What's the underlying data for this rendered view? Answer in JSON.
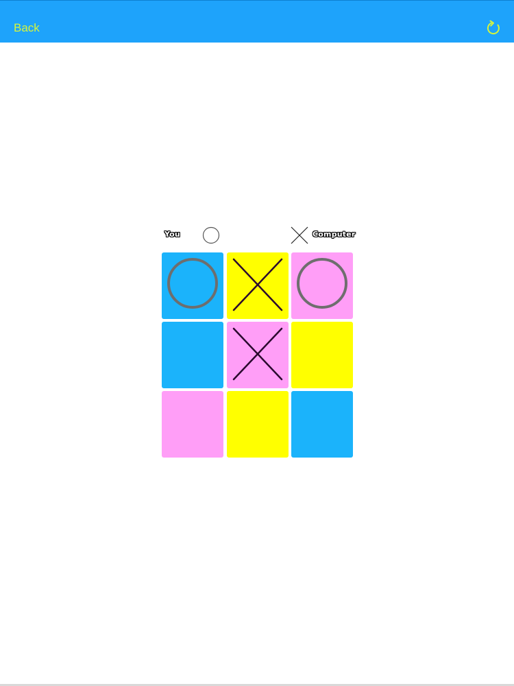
{
  "nav": {
    "back_label": "Back",
    "refresh_icon": "refresh-icon",
    "bar_color": "#1ea3fb",
    "text_color": "#d6f53b"
  },
  "players": {
    "you": {
      "label": "You",
      "symbol": "O"
    },
    "computer": {
      "label": "Computer",
      "symbol": "X"
    }
  },
  "board": {
    "cells": [
      {
        "color": "#1bb3fb",
        "mark": "O"
      },
      {
        "color": "#ffff00",
        "mark": "X"
      },
      {
        "color": "#ff9ef7",
        "mark": "O"
      },
      {
        "color": "#1bb3fb",
        "mark": ""
      },
      {
        "color": "#ff9ef7",
        "mark": "X"
      },
      {
        "color": "#ffff00",
        "mark": ""
      },
      {
        "color": "#ff9ef7",
        "mark": ""
      },
      {
        "color": "#ffff00",
        "mark": ""
      },
      {
        "color": "#1bb3fb",
        "mark": ""
      }
    ],
    "o_color": "#6e6e6e",
    "x_color": "#2b0a2e"
  }
}
